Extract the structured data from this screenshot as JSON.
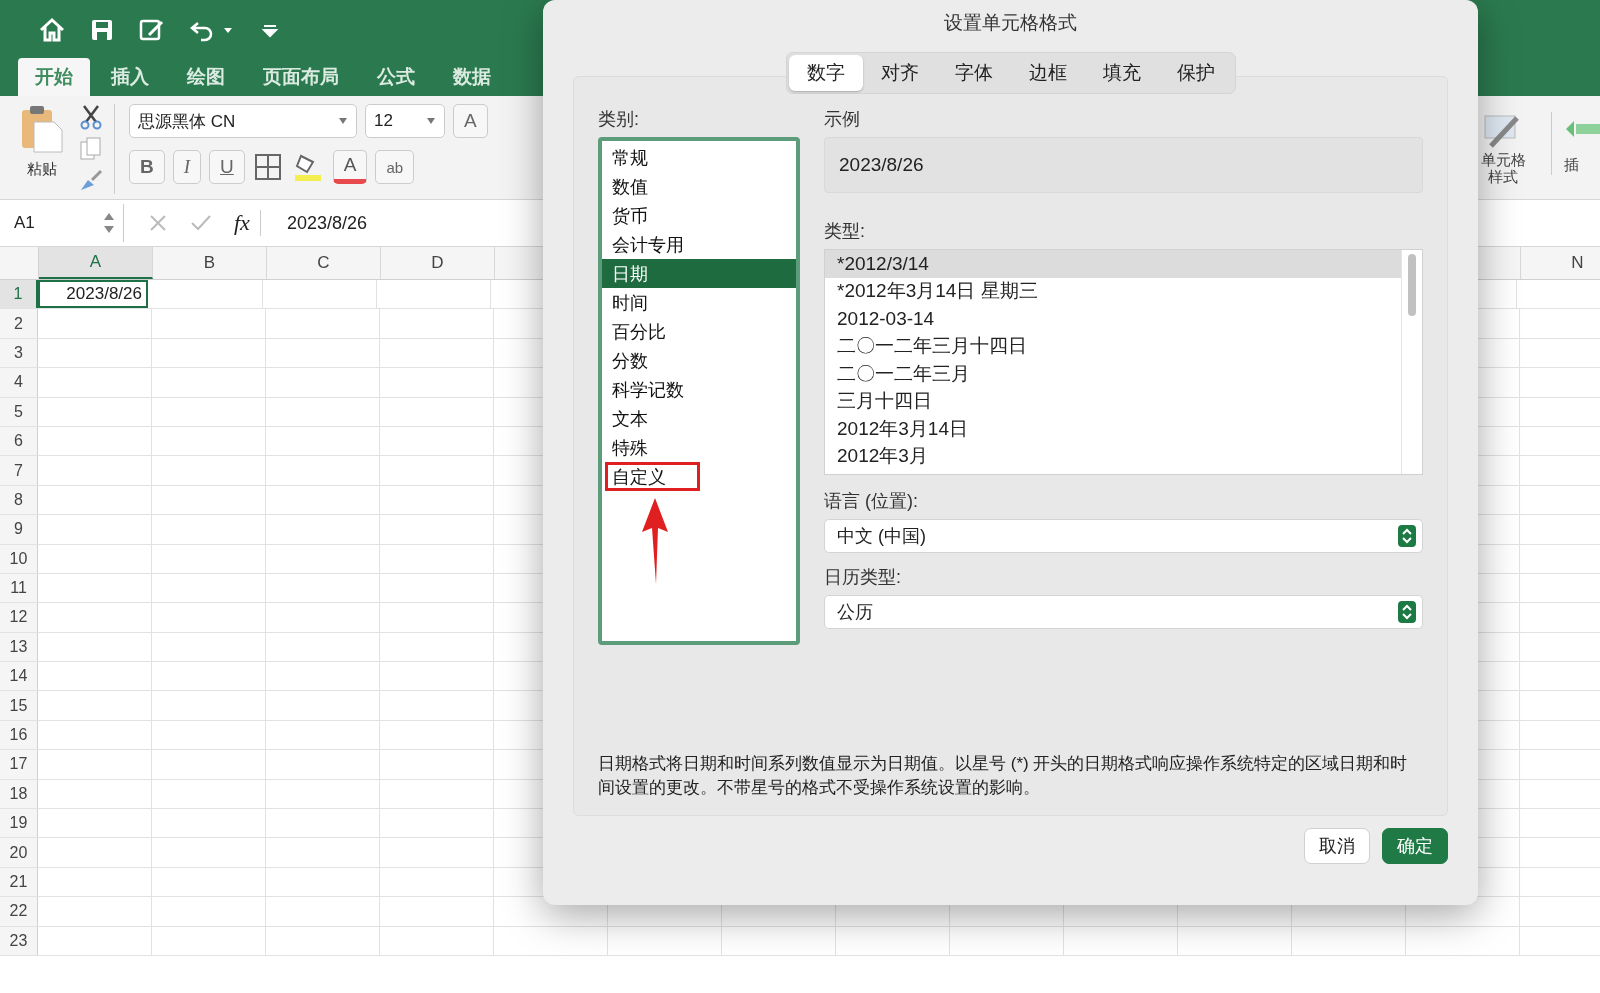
{
  "ribbon_tabs": [
    {
      "label": "开始",
      "selected": true
    },
    {
      "label": "插入",
      "selected": false
    },
    {
      "label": "绘图",
      "selected": false
    },
    {
      "label": "页面布局",
      "selected": false
    },
    {
      "label": "公式",
      "selected": false
    },
    {
      "label": "数据",
      "selected": false
    }
  ],
  "ribbon": {
    "paste_label": "粘贴",
    "font_name": "思源黑体 CN",
    "font_size": "12",
    "grow_font": "A",
    "bold": "B",
    "italic": "I",
    "underline": "U",
    "font_color": "A",
    "wrap": "ab",
    "cell_styles_label": "单元格样式",
    "insert_label": "插"
  },
  "formula_bar": {
    "name_box": "A1",
    "fx": "fx",
    "content": "2023/8/26"
  },
  "sheet": {
    "columns": [
      {
        "label": "A",
        "selected": true
      },
      {
        "label": "B",
        "selected": false
      },
      {
        "label": "C",
        "selected": false
      },
      {
        "label": "D",
        "selected": false
      }
    ],
    "last_column": "N",
    "rows": [
      {
        "label": "1",
        "selected": true
      },
      {
        "label": "2",
        "selected": false
      },
      {
        "label": "3",
        "selected": false
      },
      {
        "label": "4",
        "selected": false
      },
      {
        "label": "5",
        "selected": false
      },
      {
        "label": "6",
        "selected": false
      },
      {
        "label": "7",
        "selected": false
      },
      {
        "label": "8",
        "selected": false
      },
      {
        "label": "9",
        "selected": false
      },
      {
        "label": "10",
        "selected": false
      },
      {
        "label": "11",
        "selected": false
      },
      {
        "label": "12",
        "selected": false
      },
      {
        "label": "13",
        "selected": false
      },
      {
        "label": "14",
        "selected": false
      },
      {
        "label": "15",
        "selected": false
      },
      {
        "label": "16",
        "selected": false
      },
      {
        "label": "17",
        "selected": false
      },
      {
        "label": "18",
        "selected": false
      },
      {
        "label": "19",
        "selected": false
      },
      {
        "label": "20",
        "selected": false
      },
      {
        "label": "21",
        "selected": false
      },
      {
        "label": "22",
        "selected": false
      },
      {
        "label": "23",
        "selected": false
      }
    ],
    "active_cell": {
      "value": "2023/8/26",
      "selected": true
    }
  },
  "dialog": {
    "title": "设置单元格格式",
    "tabs": [
      {
        "label": "数字",
        "selected": true
      },
      {
        "label": "对齐",
        "selected": false
      },
      {
        "label": "字体",
        "selected": false
      },
      {
        "label": "边框",
        "selected": false
      },
      {
        "label": "填充",
        "selected": false
      },
      {
        "label": "保护",
        "selected": false
      }
    ],
    "category_label": "类别:",
    "categories": [
      {
        "label": "常规",
        "selected": false,
        "highlighted": false
      },
      {
        "label": "数值",
        "selected": false,
        "highlighted": false
      },
      {
        "label": "货币",
        "selected": false,
        "highlighted": false
      },
      {
        "label": "会计专用",
        "selected": false,
        "highlighted": false
      },
      {
        "label": "日期",
        "selected": true,
        "highlighted": false
      },
      {
        "label": "时间",
        "selected": false,
        "highlighted": false
      },
      {
        "label": "百分比",
        "selected": false,
        "highlighted": false
      },
      {
        "label": "分数",
        "selected": false,
        "highlighted": false
      },
      {
        "label": "科学记数",
        "selected": false,
        "highlighted": false
      },
      {
        "label": "文本",
        "selected": false,
        "highlighted": false
      },
      {
        "label": "特殊",
        "selected": false,
        "highlighted": false
      },
      {
        "label": "自定义",
        "selected": false,
        "highlighted": true
      }
    ],
    "sample_label": "示例",
    "sample_value": "2023/8/26",
    "type_label": "类型:",
    "types": [
      {
        "label": "*2012/3/14",
        "selected": true
      },
      {
        "label": "*2012年3月14日 星期三",
        "selected": false
      },
      {
        "label": "2012-03-14",
        "selected": false
      },
      {
        "label": "二〇一二年三月十四日",
        "selected": false
      },
      {
        "label": "二〇一二年三月",
        "selected": false
      },
      {
        "label": "三月十四日",
        "selected": false
      },
      {
        "label": "2012年3月14日",
        "selected": false
      },
      {
        "label": "2012年3月",
        "selected": false
      }
    ],
    "language_label": "语言 (位置):",
    "language_value": "中文 (中国)",
    "calendar_label": "日历类型:",
    "calendar_value": "公历",
    "description": "日期格式将日期和时间系列数值显示为日期值。以星号 (*) 开头的日期格式响应操作系统特定的区域日期和时间设置的更改。不带星号的格式不受操作系统设置的影响。",
    "buttons": [
      {
        "label": "取消",
        "kind": "secondary"
      },
      {
        "label": "确定",
        "kind": "primary"
      }
    ]
  }
}
